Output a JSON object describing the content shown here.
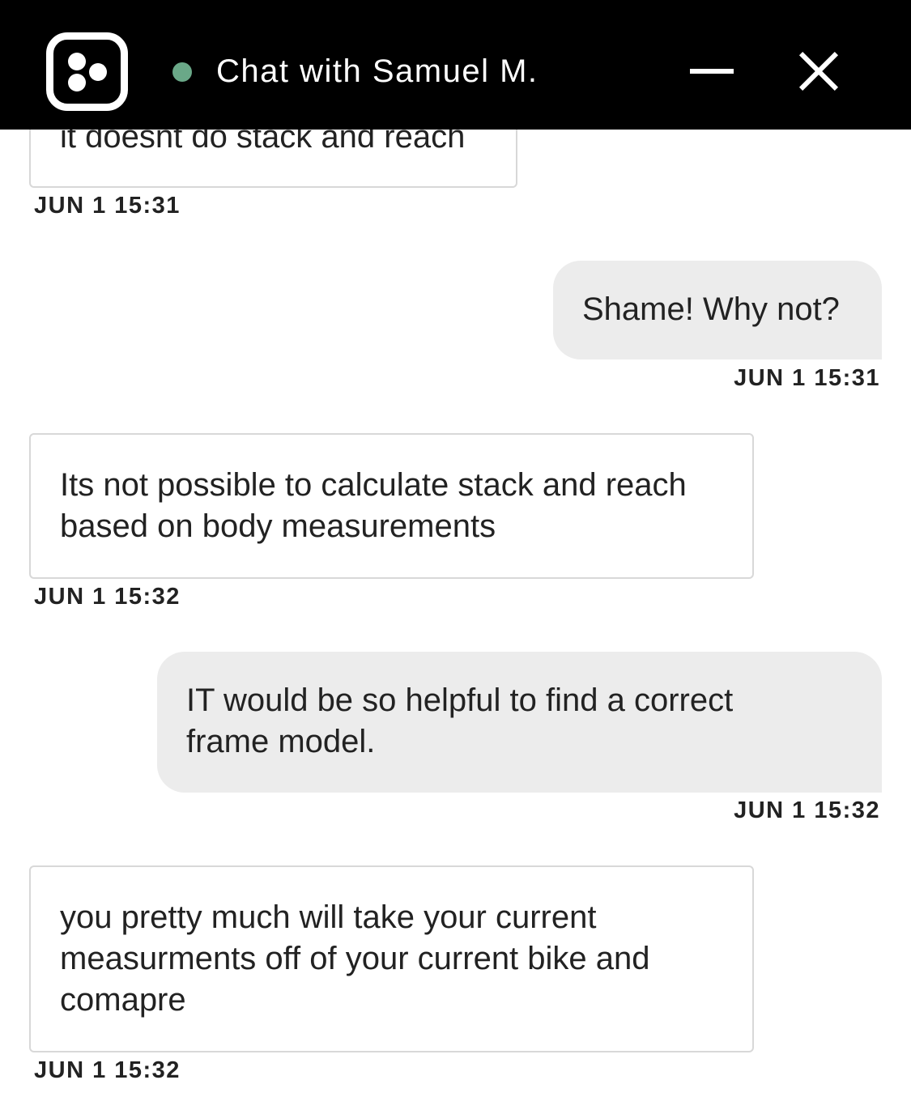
{
  "header": {
    "title": "Chat with Samuel M.",
    "status_color": "#6aa888",
    "logo_icon": "chat-brand-logo",
    "minimize_icon": "minimize-icon",
    "close_icon": "close-icon"
  },
  "messages": [
    {
      "sender": "agent",
      "text": "it doesnt do stack and reach",
      "time": "JUN 1 15:31"
    },
    {
      "sender": "user",
      "text": "Shame! Why not?",
      "time": "JUN 1 15:31"
    },
    {
      "sender": "agent",
      "text": "Its not possible to calculate stack and reach based on body measurements",
      "time": "JUN 1 15:32"
    },
    {
      "sender": "user",
      "text": "IT would be so helpful to find a correct frame model.",
      "time": "JUN 1 15:32"
    },
    {
      "sender": "agent",
      "text": "you pretty much will take your current measurments off of your current bike and comapre",
      "time": "JUN 1 15:32"
    }
  ]
}
